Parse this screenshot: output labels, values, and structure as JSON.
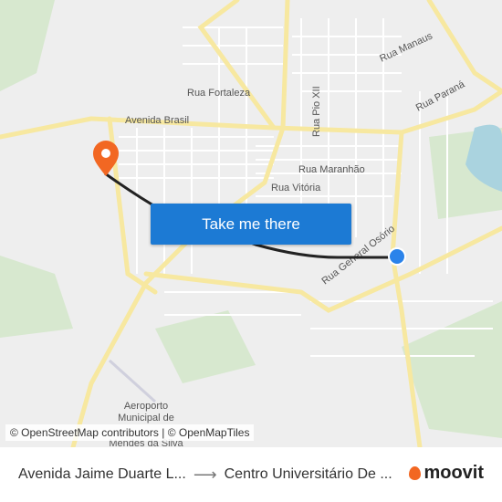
{
  "map": {
    "street_labels": [
      "Rua Manaus",
      "Rua Fortaleza",
      "Avenida Brasil",
      "Rua Pio XII",
      "Rua Paraná",
      "Rua Maranhão",
      "Rua Vitória",
      "Rua General Osório"
    ],
    "poi_labels": [
      "Aeroporto",
      "Municipal de",
      "Mendes da Silva"
    ],
    "attribution": "© OpenStreetMap contributors | © OpenMapTiles",
    "colors": {
      "route": "#222222",
      "origin_pin": "#2b83ea",
      "destination_pin": "#f26722",
      "button": "#1c7ad4",
      "roads": "#f7e8a0"
    }
  },
  "cta": {
    "label": "Take me there"
  },
  "footer": {
    "origin": "Avenida Jaime Duarte L...",
    "arrow": "⟶",
    "destination": "Centro Universitário De ...",
    "brand": "moovit"
  }
}
